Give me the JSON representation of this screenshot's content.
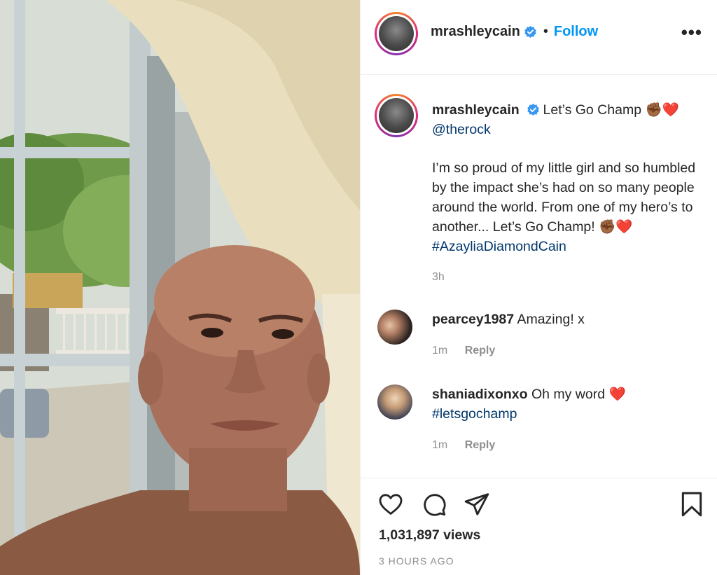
{
  "post": {
    "author": "mrashleycain",
    "verified": true,
    "header_separator": "•",
    "follow_label": "Follow",
    "more_label": "•••",
    "media_description_icon": "video-frame"
  },
  "caption": {
    "username": "mrashleycain",
    "first_line": "Let’s Go Champ",
    "emoji_1": "✊🏾❤️",
    "mention": "@therock",
    "body": "I’m so proud of my little girl and so humbled by the impact she’s had on so many people around the world. From one of my hero’s to another... Let’s Go Champ!",
    "emoji_2": "✊🏾❤️",
    "hashtag": "#AzayliaDiamondCain",
    "time": "3h"
  },
  "comments": [
    {
      "username": "pearcey1987",
      "text": "Amazing! x",
      "hashtag": "",
      "emoji": "",
      "time": "1m",
      "reply_label": "Reply"
    },
    {
      "username": "shaniadixonxo",
      "text": "Oh my word",
      "emoji": "❤️",
      "hashtag": "#letsgochamp",
      "time": "1m",
      "reply_label": "Reply"
    }
  ],
  "footer": {
    "views": "1,031,897 views",
    "time_ago": "3 HOURS AGO",
    "icons": [
      "heart-icon",
      "comment-icon",
      "share-icon",
      "bookmark-icon"
    ]
  },
  "colors": {
    "link": "#00376b",
    "follow": "#0095f6",
    "verified": "#3897f0",
    "muted": "#8e8e8e",
    "heart_emoji": "#e0245e",
    "fist_emoji": "#8d5524"
  }
}
